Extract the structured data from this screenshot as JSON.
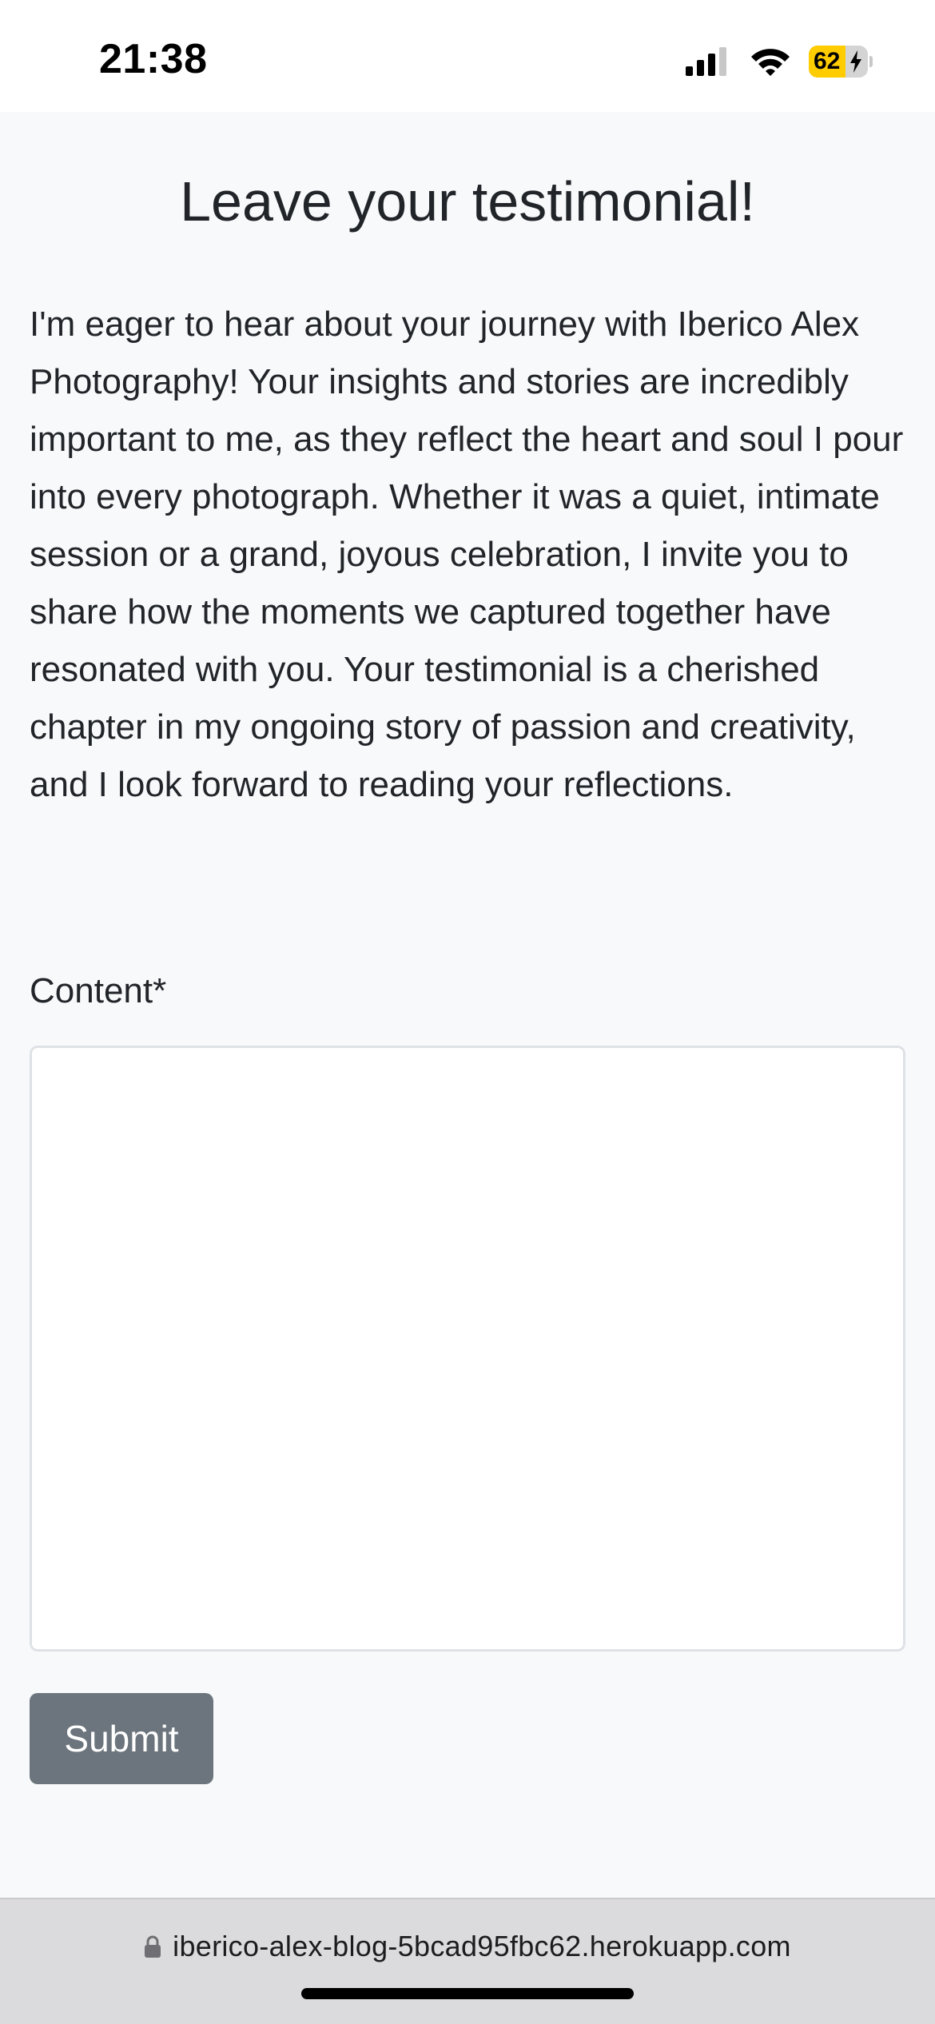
{
  "status_bar": {
    "time": "21:38",
    "battery_level": "62",
    "battery_fraction": 0.62,
    "icons": [
      "signal-icon",
      "wifi-icon",
      "battery-icon",
      "bolt-icon"
    ]
  },
  "page": {
    "title": "Leave your testimonial!",
    "intro": "I'm eager to hear about your journey with Iberico Alex Photography! Your insights and stories are incredibly important to me, as they reflect the heart and soul I pour into every photograph. Whether it was a quiet, intimate session or a grand, joyous celebration, I invite you to share how the moments we captured together have resonated with you. Your testimonial is a cherished chapter in my ongoing story of passion and creativity, and I look forward to reading your reflections."
  },
  "form": {
    "content_label": "Content*",
    "content_value": "",
    "submit_label": "Submit"
  },
  "browser": {
    "url": "iberico-alex-blog-5bcad95fbc62.herokuapp.com"
  },
  "colors": {
    "background": "#f8f9fa",
    "button": "#6c757d",
    "battery_fill": "#ffcc00"
  }
}
